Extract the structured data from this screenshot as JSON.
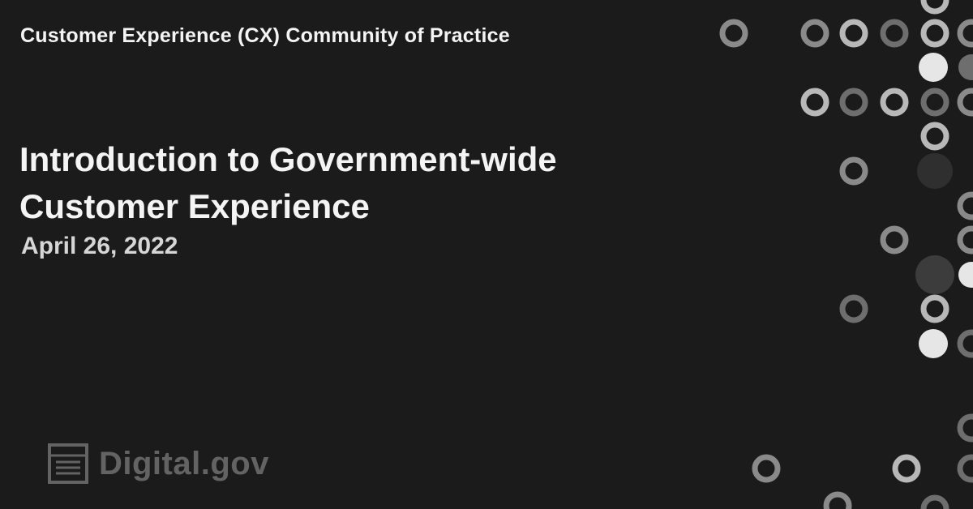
{
  "header": {
    "eyebrow": "Customer Experience (CX) Community of Practice"
  },
  "main": {
    "title_line1": "Introduction to Government-wide",
    "title_line2": "Customer Experience",
    "date": "April 26, 2022"
  },
  "branding": {
    "logo_text": "Digital.gov",
    "logo_icon": "digitalgov-logo-icon"
  },
  "colors": {
    "background": "#1b1b1b",
    "text": "#f4f4f4",
    "dot_light": "#e6e6e6",
    "dot_mid": "#8a8a8a",
    "dot_dark": "#3c3c3c"
  }
}
